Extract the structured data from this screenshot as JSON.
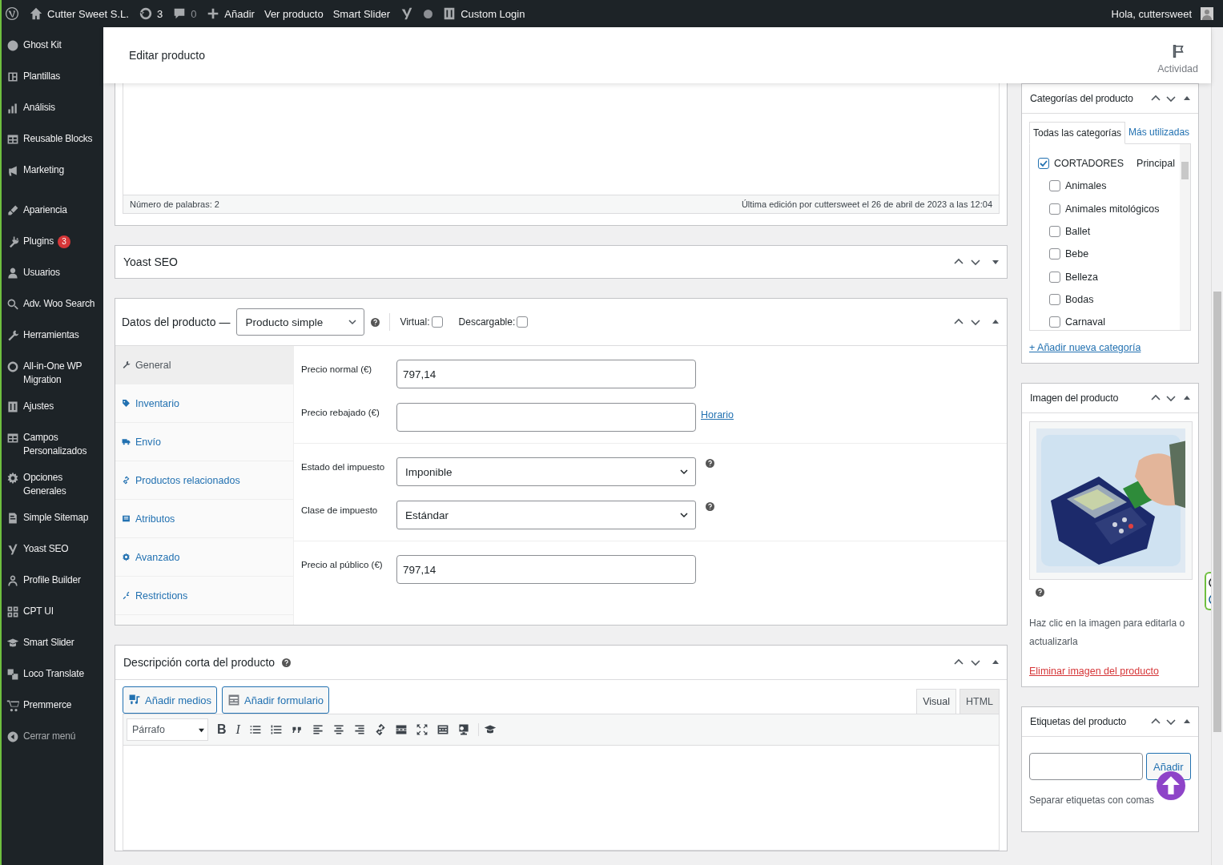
{
  "admin_bar": {
    "site_name": "Cutter Sweet S.L.",
    "updates_count": "3",
    "comments_count": "0",
    "new_label": "Añadir",
    "links": [
      "Ver producto",
      "Smart Slider"
    ],
    "custom_login": "Custom Login",
    "greeting": "Hola, cuttersweet"
  },
  "sidebar": {
    "items": [
      {
        "kind": "menu",
        "label": "Ghost Kit"
      },
      {
        "kind": "menu",
        "label": "Plantillas"
      },
      {
        "kind": "menu",
        "label": "Análisis"
      },
      {
        "kind": "menu",
        "label": "Reusable Blocks"
      },
      {
        "kind": "menu",
        "label": "Marketing"
      },
      {
        "kind": "menu",
        "label": "Apariencia"
      },
      {
        "kind": "menu",
        "label": "Plugins",
        "badge": "3"
      },
      {
        "kind": "menu",
        "label": "Usuarios"
      },
      {
        "kind": "menu",
        "label": "Adv. Woo Search"
      },
      {
        "kind": "menu",
        "label": "Herramientas"
      },
      {
        "kind": "menu",
        "label": "All-in-One WP Migration"
      },
      {
        "kind": "menu",
        "label": "Ajustes"
      },
      {
        "kind": "menu",
        "label": "Campos Personalizados"
      },
      {
        "kind": "menu",
        "label": "Opciones Generales"
      },
      {
        "kind": "menu",
        "label": "Simple Sitemap"
      },
      {
        "kind": "menu",
        "label": "Yoast SEO"
      },
      {
        "kind": "menu",
        "label": "Profile Builder"
      },
      {
        "kind": "menu",
        "label": "CPT UI"
      },
      {
        "kind": "menu",
        "label": "Smart Slider"
      },
      {
        "kind": "menu",
        "label": "Loco Translate"
      },
      {
        "kind": "menu",
        "label": "Premmerce"
      },
      {
        "kind": "collapse",
        "label": "Cerrar menú"
      }
    ]
  },
  "header": {
    "title": "Editar producto",
    "activity": "Actividad"
  },
  "editor": {
    "word_count": "Número de palabras: 2",
    "last_edit": "Última edición por cuttersweet el 26 de abril de 2023 a las 12:04"
  },
  "yoast": {
    "title": "Yoast SEO"
  },
  "product_data": {
    "title": "Datos del producto —",
    "type": "Producto simple",
    "virtual": {
      "label": "Virtual:",
      "checked": false
    },
    "downloadable": {
      "label": "Descargable:",
      "checked": false
    },
    "tabs": [
      {
        "label": "General",
        "selected": true
      },
      {
        "label": "Inventario",
        "selected": false
      },
      {
        "label": "Envío",
        "selected": false
      },
      {
        "label": "Productos relacionados",
        "selected": false
      },
      {
        "label": "Atributos",
        "selected": false
      },
      {
        "label": "Avanzado",
        "selected": false
      },
      {
        "label": "Restrictions",
        "selected": false
      }
    ],
    "field_groups": [
      [
        {
          "kind": "text",
          "label": "Precio normal (€)",
          "value": "797,14"
        },
        {
          "kind": "text",
          "label": "Precio rebajado (€)",
          "link": "Horario"
        }
      ],
      [
        {
          "kind": "select",
          "label": "Estado del impuesto",
          "value": "Imponible"
        },
        {
          "kind": "select",
          "label": "Clase de impuesto",
          "value": "Estándar"
        }
      ],
      [
        {
          "kind": "text",
          "label": "Precio al público (€)",
          "value": "797,14"
        }
      ]
    ]
  },
  "short_description": {
    "title": "Descripción corta del producto",
    "media_buttons": [
      "Añadir medios",
      "Añadir formulario"
    ],
    "editor_tabs": [
      {
        "label": "Visual",
        "selected": true
      },
      {
        "label": "HTML",
        "selected": false
      }
    ],
    "format": "Párrafo",
    "format_buttons": [
      "B",
      "I"
    ]
  },
  "categories": {
    "title": "Categorías del producto",
    "tabs": [
      {
        "label": "Todas las categorías",
        "selected": true
      },
      {
        "label": "Más utilizadas",
        "selected": false
      }
    ],
    "items": [
      {
        "label": "CORTADORES",
        "checked": true,
        "primary_label": "Principal",
        "children": [
          {
            "label": "Animales",
            "checked": false
          },
          {
            "label": "Animales mitológicos",
            "checked": false
          },
          {
            "label": "Ballet",
            "checked": false
          },
          {
            "label": "Bebe",
            "checked": false
          },
          {
            "label": "Belleza",
            "checked": false
          },
          {
            "label": "Bodas",
            "checked": false
          },
          {
            "label": "Carnaval",
            "checked": false
          }
        ]
      }
    ],
    "add_link": "+ Añadir nueva categoría"
  },
  "product_image": {
    "title": "Imagen del producto",
    "hint": "Haz clic en la imagen para editarla o actualizarla",
    "remove_link": "Eliminar imagen del producto"
  },
  "tags": {
    "title": "Etiquetas del producto",
    "button": "Añadir",
    "note": "Separar etiquetas con comas"
  }
}
